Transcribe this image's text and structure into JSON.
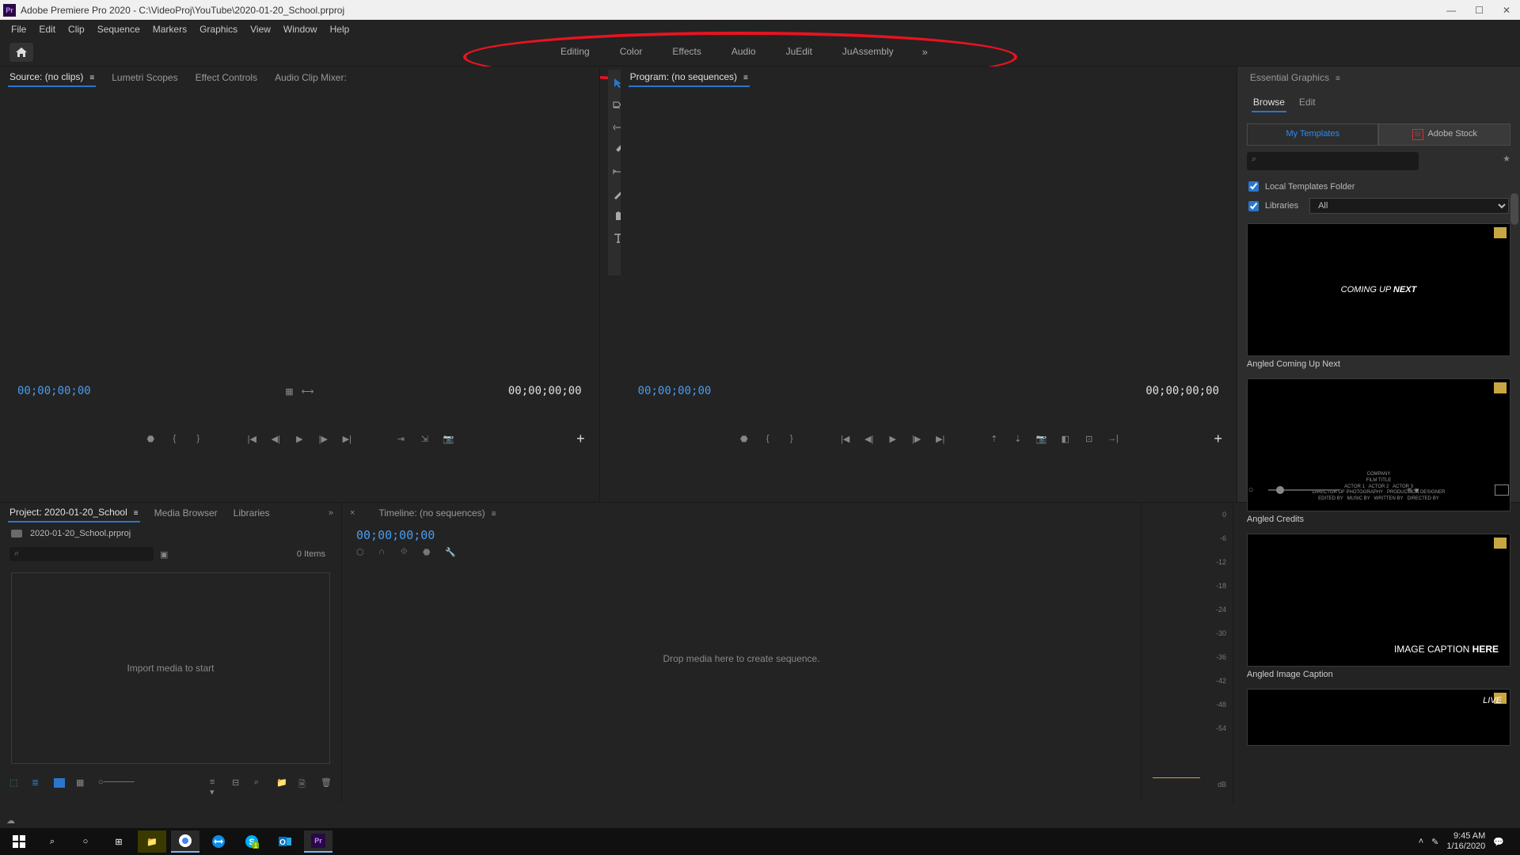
{
  "titlebar": {
    "app_icon_text": "Pr",
    "title": "Adobe Premiere Pro 2020 - C:\\VideoProj\\YouTube\\2020-01-20_School.prproj",
    "min": "—",
    "max": "☐",
    "close": "✕"
  },
  "menubar": [
    "File",
    "Edit",
    "Clip",
    "Sequence",
    "Markers",
    "Graphics",
    "View",
    "Window",
    "Help"
  ],
  "workspaces": {
    "tabs": [
      "Editing",
      "Color",
      "Effects",
      "Audio",
      "JuEdit",
      "JuAssembly"
    ],
    "more": "»"
  },
  "source_panel": {
    "tabs": [
      "Source: (no clips)",
      "Lumetri Scopes",
      "Effect Controls",
      "Audio Clip Mixer:"
    ],
    "active": 0,
    "tc_left": "00;00;00;00",
    "tc_right": "00;00;00;00",
    "add": "+"
  },
  "program_panel": {
    "tab": "Program: (no sequences)",
    "tc_left": "00;00;00;00",
    "tc_right": "00;00;00;00",
    "add": "+"
  },
  "tools": [
    "selection",
    "track-select",
    "ripple",
    "rate-stretch",
    "slip",
    "pen",
    "hand",
    "type"
  ],
  "project_panel": {
    "tabs": [
      "Project: 2020-01-20_School",
      "Media Browser",
      "Libraries"
    ],
    "more": "»",
    "file": "2020-01-20_School.prproj",
    "search_placeholder": "",
    "count": "0 Items",
    "drop_text": "Import media to start"
  },
  "timeline_panel": {
    "close": "×",
    "tab": "Timeline: (no sequences)",
    "tc": "00;00;00;00",
    "drop_text": "Drop media here to create sequence."
  },
  "meters": {
    "scale": [
      "0",
      "-6",
      "-12",
      "-18",
      "-24",
      "-30",
      "-36",
      "-42",
      "-48",
      "-54"
    ],
    "unit": "dB"
  },
  "essential_graphics": {
    "title": "Essential Graphics",
    "subtabs": [
      "Browse",
      "Edit"
    ],
    "src_tabs": {
      "my": "My Templates",
      "stock": "Adobe Stock",
      "stock_badge": "St"
    },
    "search_placeholder": "",
    "star": "★",
    "check_local": "Local Templates Folder",
    "check_libs": "Libraries",
    "lib_select": "All",
    "templates": [
      {
        "name": "Angled Coming Up Next",
        "text": "COMING UP",
        "bold": "NEXT"
      },
      {
        "name": "Angled Credits"
      },
      {
        "name": "Angled Image Caption",
        "text": "IMAGE CAPTION",
        "bold": "HERE"
      },
      {
        "name": "",
        "live": "LIVE"
      }
    ]
  },
  "taskbar": {
    "icons": [
      "start",
      "search",
      "cortana",
      "taskview",
      "explorer",
      "chrome",
      "teamviewer",
      "skype",
      "outlook",
      "premiere"
    ],
    "time": "9:45 AM",
    "date": "1/16/2020"
  }
}
